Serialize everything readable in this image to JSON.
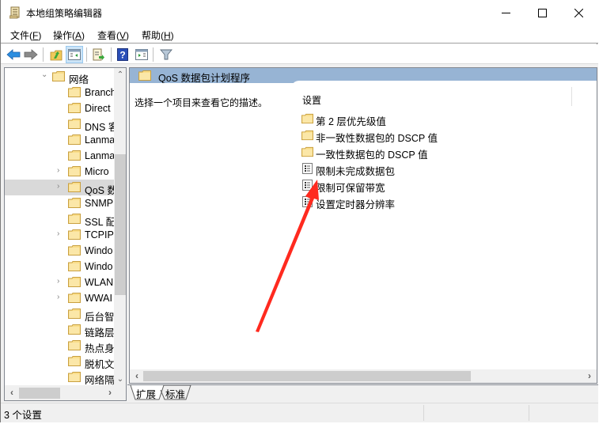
{
  "window": {
    "title": "本地组策略编辑器",
    "controls": {
      "minimize": "minimize",
      "maximize": "maximize",
      "close": "close"
    }
  },
  "menu": [
    {
      "label": "文件(",
      "key": "F",
      "end": ")"
    },
    {
      "label": "操作(",
      "key": "A",
      "end": ")"
    },
    {
      "label": "查看(",
      "key": "V",
      "end": ")"
    },
    {
      "label": "帮助(",
      "key": "H",
      "end": ")"
    }
  ],
  "toolbar": {
    "items": [
      "back-icon",
      "forward-icon",
      "up-folder-icon",
      "show-hide-console-tree-icon",
      "export-list-icon",
      "help-icon",
      "show-hide-action-pane-icon",
      "filter-icon"
    ],
    "active": "show-hide-console-tree-icon"
  },
  "tree": {
    "items": [
      {
        "label": "网络",
        "expander": "expanded"
      },
      {
        "label": "Branch",
        "expander": "none"
      },
      {
        "label": "Direct",
        "expander": "none"
      },
      {
        "label": "DNS 客",
        "expander": "none"
      },
      {
        "label": "Lanma",
        "expander": "none"
      },
      {
        "label": "Lanma",
        "expander": "none"
      },
      {
        "label": "Micro",
        "expander": "collapsed"
      },
      {
        "label": "QoS 数",
        "expander": "collapsed",
        "selected": true
      },
      {
        "label": "SNMP",
        "expander": "none"
      },
      {
        "label": "SSL 配",
        "expander": "none"
      },
      {
        "label": "TCPIP",
        "expander": "collapsed"
      },
      {
        "label": "Windo",
        "expander": "none"
      },
      {
        "label": "Windo",
        "expander": "none"
      },
      {
        "label": "WLAN",
        "expander": "collapsed"
      },
      {
        "label": "WWAI",
        "expander": "collapsed"
      },
      {
        "label": "后台智",
        "expander": "none"
      },
      {
        "label": "链路层",
        "expander": "none"
      },
      {
        "label": "热点身",
        "expander": "none"
      },
      {
        "label": "脱机文",
        "expander": "none"
      },
      {
        "label": "网络隔",
        "expander": "none"
      }
    ]
  },
  "main": {
    "header_title": "QoS 数据包计划程序",
    "description": "选择一个项目来查看它的描述。",
    "column_header": "设置",
    "items": [
      {
        "label": "第 2 层优先级值",
        "type": "folder"
      },
      {
        "label": "非一致性数据包的 DSCP 值",
        "type": "folder"
      },
      {
        "label": "一致性数据包的 DSCP 值",
        "type": "folder"
      },
      {
        "label": "限制未完成数据包",
        "type": "setting"
      },
      {
        "label": "限制可保留带宽",
        "type": "setting",
        "annotated": true
      },
      {
        "label": "设置定时器分辨率",
        "type": "setting"
      }
    ]
  },
  "tabs": [
    {
      "label": "扩展",
      "active": true
    },
    {
      "label": "标准",
      "active": false
    }
  ],
  "status": {
    "text": "3 个设置"
  },
  "annotation": {
    "type": "arrow",
    "color": "#ff2a1f",
    "points_to": "限制可保留带宽"
  }
}
